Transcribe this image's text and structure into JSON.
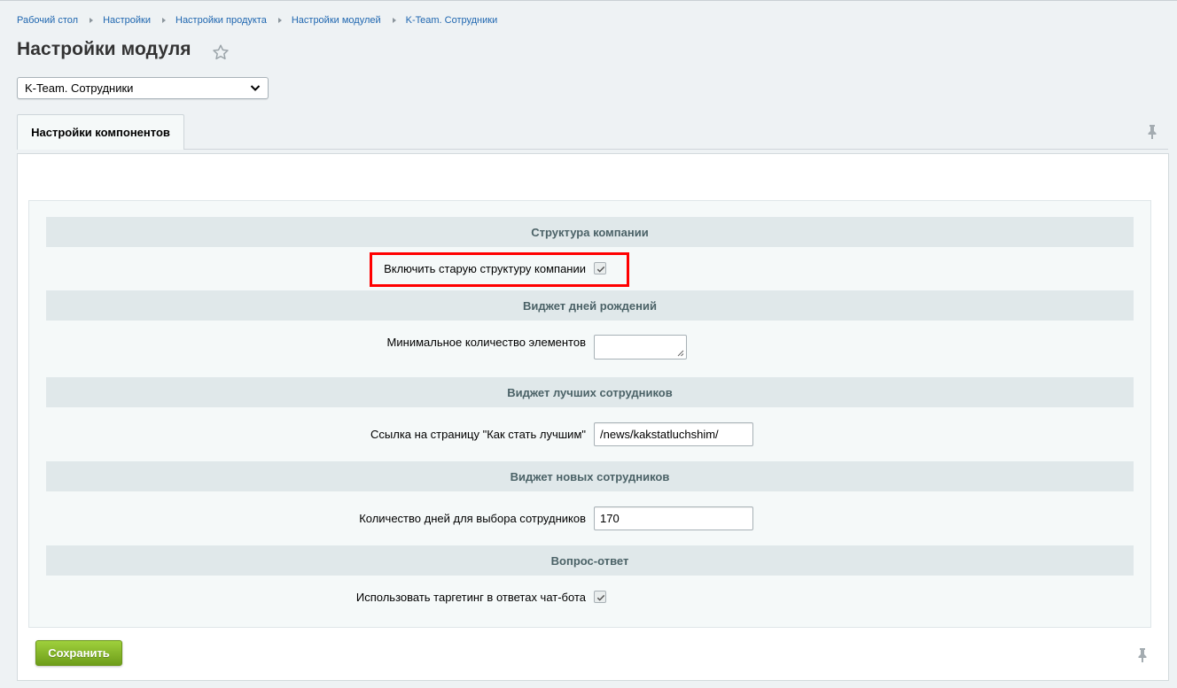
{
  "breadcrumb": [
    "Рабочий стол",
    "Настройки",
    "Настройки продукта",
    "Настройки модулей",
    "K-Team. Сотрудники"
  ],
  "page_title": "Настройки модуля",
  "module_select": {
    "value": "K-Team. Сотрудники"
  },
  "tabs": [
    {
      "label": "Настройки компонентов",
      "active": true
    }
  ],
  "sections": {
    "structure": {
      "title": "Структура компании",
      "enable_old_structure": {
        "label": "Включить старую структуру компании",
        "checked": true
      }
    },
    "birthdays": {
      "title": "Виджет дней рождений",
      "min_elements": {
        "label": "Минимальное количество элементов",
        "value": ""
      }
    },
    "best": {
      "title": "Виджет лучших сотрудников",
      "link": {
        "label": "Ссылка на страницу \"Как стать лучшим\"",
        "value": "/news/kakstatluchshim/"
      }
    },
    "new_employees": {
      "title": "Виджет новых сотрудников",
      "days": {
        "label": "Количество дней для выбора сотрудников",
        "value": "170"
      }
    },
    "faq": {
      "title": "Вопрос-ответ",
      "targeting": {
        "label": "Использовать таргетинг в ответах чат-бота",
        "checked": true
      }
    }
  },
  "save_label": "Сохранить",
  "colors": {
    "highlight": "#ff0000",
    "save_button": "#7fb12a",
    "link": "#2067b0"
  }
}
